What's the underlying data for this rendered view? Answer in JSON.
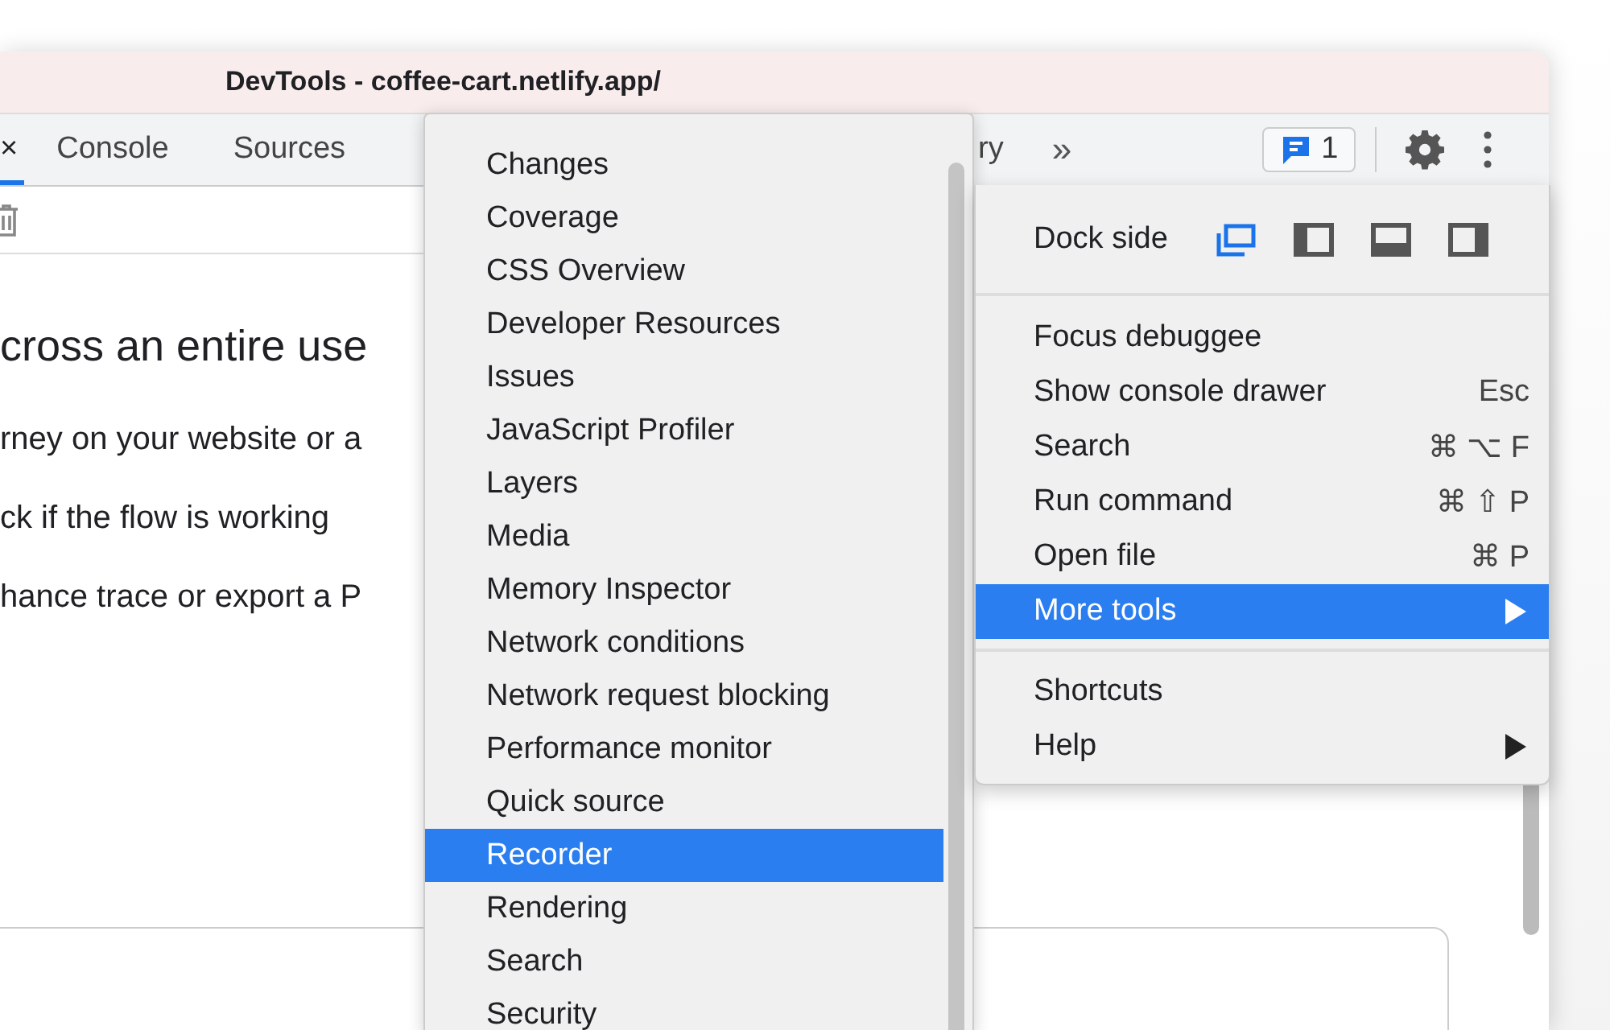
{
  "window": {
    "title": "DevTools - coffee-cart.netlify.app/"
  },
  "tabs": [
    {
      "label": "×",
      "selected": true
    },
    {
      "label": "Console",
      "selected": false
    },
    {
      "label": "Sources",
      "selected": false
    },
    {
      "label": "ry",
      "selected": false
    }
  ],
  "overflow_button": "»",
  "issues_badge": {
    "count": "1"
  },
  "content": {
    "heading": "cross an entire use",
    "lines": [
      "rney on your website or a",
      "ck if the flow is working",
      "hance trace or export a P"
    ]
  },
  "more_tools_menu": [
    {
      "label": "Changes",
      "selected": false
    },
    {
      "label": "Coverage",
      "selected": false
    },
    {
      "label": "CSS Overview",
      "selected": false
    },
    {
      "label": "Developer Resources",
      "selected": false
    },
    {
      "label": "Issues",
      "selected": false
    },
    {
      "label": "JavaScript Profiler",
      "selected": false
    },
    {
      "label": "Layers",
      "selected": false
    },
    {
      "label": "Media",
      "selected": false
    },
    {
      "label": "Memory Inspector",
      "selected": false
    },
    {
      "label": "Network conditions",
      "selected": false
    },
    {
      "label": "Network request blocking",
      "selected": false
    },
    {
      "label": "Performance monitor",
      "selected": false
    },
    {
      "label": "Quick source",
      "selected": false
    },
    {
      "label": "Recorder",
      "selected": true
    },
    {
      "label": "Rendering",
      "selected": false
    },
    {
      "label": "Search",
      "selected": false
    },
    {
      "label": "Security",
      "selected": false
    }
  ],
  "main_menu": {
    "dock_side": {
      "label": "Dock side",
      "options": [
        {
          "kind": "undock",
          "selected": true
        },
        {
          "kind": "left",
          "selected": false
        },
        {
          "kind": "bottom",
          "selected": false
        },
        {
          "kind": "right",
          "selected": false
        }
      ]
    },
    "sections": [
      [
        {
          "label": "Focus debuggee",
          "submenu": false,
          "selected": false
        },
        {
          "label": "Show console drawer",
          "shortcut": "Esc",
          "submenu": false,
          "selected": false
        },
        {
          "label": "Search",
          "shortcut": "⌘ ⌥ F",
          "submenu": false,
          "selected": false
        },
        {
          "label": "Run command",
          "shortcut": "⌘ ⇧ P",
          "submenu": false,
          "selected": false
        },
        {
          "label": "Open file",
          "shortcut": "⌘ P",
          "submenu": false,
          "selected": false
        },
        {
          "label": "More tools",
          "submenu": true,
          "selected": true
        }
      ],
      [
        {
          "label": "Shortcuts",
          "submenu": false,
          "selected": false
        },
        {
          "label": "Help",
          "submenu": true,
          "selected": false
        }
      ]
    ]
  }
}
